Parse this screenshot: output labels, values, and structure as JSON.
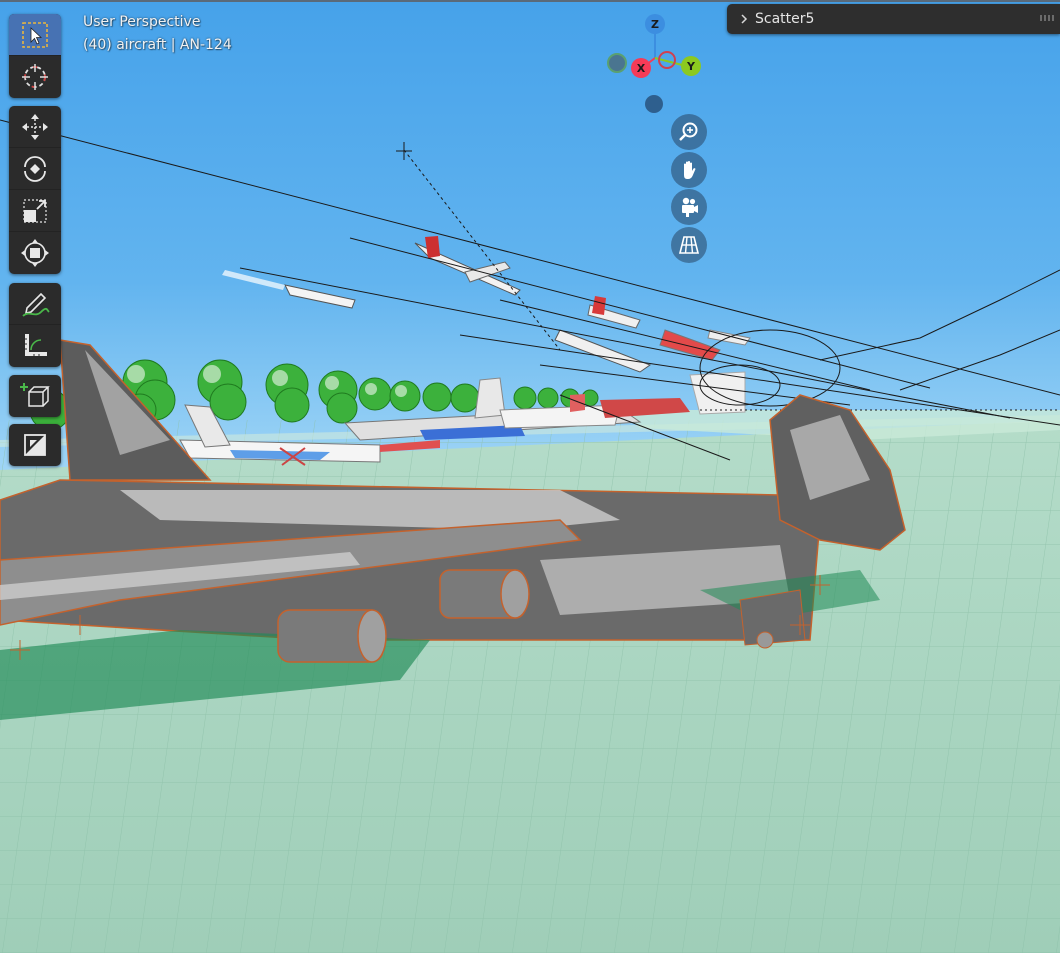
{
  "viewport": {
    "view_name": "User Perspective",
    "object_info": "(40) aircraft | AN-124"
  },
  "gizmo": {
    "z_label": "Z",
    "x_label": "X",
    "y_label": "Y"
  },
  "panel": {
    "title": "Scatter5"
  },
  "toolbar": {
    "groups": [
      [
        "select-box",
        "cursor"
      ],
      [
        "move",
        "rotate",
        "scale",
        "transform"
      ],
      [
        "annotate",
        "measure"
      ],
      [
        "add-cube"
      ],
      [
        "shading"
      ]
    ]
  },
  "navigation": [
    "zoom",
    "pan",
    "camera-view",
    "ortho-toggle"
  ],
  "colors": {
    "sky_top": "#4fa6e8",
    "sky_horizon": "#9ad3f5",
    "ground": "#a8d4c0",
    "grid_line": "#8cc0a8",
    "selection_outline": "#c4622d",
    "active_tool": "#4772b3",
    "x_axis": "#f53b57",
    "y_axis": "#8cc920",
    "z_axis": "#3c8ee0"
  }
}
